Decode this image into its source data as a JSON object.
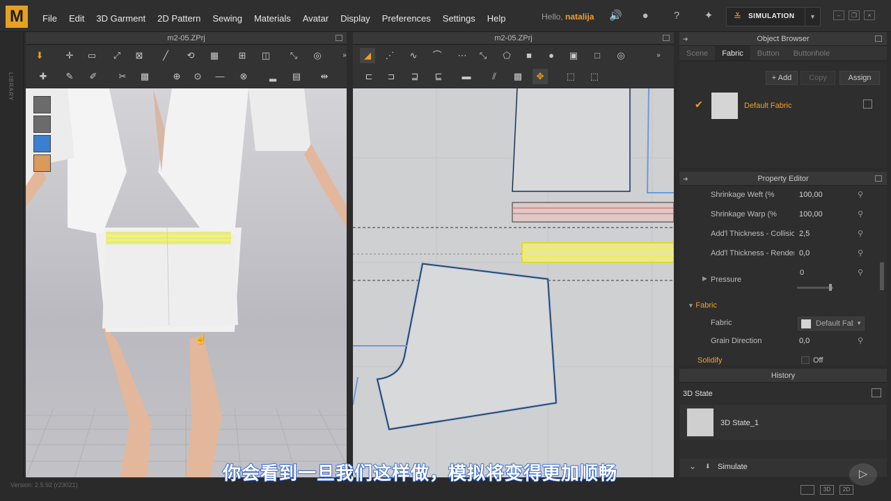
{
  "app": {
    "logo": "M",
    "user_greeting": "Hello,",
    "user_name": "natalija",
    "simulation_label": "SIMULATION"
  },
  "menu": [
    "File",
    "Edit",
    "3D Garment",
    "2D Pattern",
    "Sewing",
    "Materials",
    "Avatar",
    "Display",
    "Preferences",
    "Settings",
    "Help"
  ],
  "library_label": "LIBRARY",
  "panes": {
    "left_title": "m2-05.ZPrj",
    "right_title": "m2-05.ZPrj"
  },
  "object_browser": {
    "title": "Object Browser",
    "tabs": [
      "Scene",
      "Fabric",
      "Button",
      "Buttonhole"
    ],
    "active_tab": "Fabric",
    "add": "+ Add",
    "copy": "Copy",
    "assign": "Assign",
    "fabric_item": "Default Fabric"
  },
  "property_editor": {
    "title": "Property Editor",
    "rows": [
      {
        "k": "Shrinkage Weft (%",
        "v": "100,00"
      },
      {
        "k": "Shrinkage Warp (%",
        "v": "100,00"
      },
      {
        "k": "Add'l Thickness - Collision",
        "v": "2,5"
      },
      {
        "k": "Add'l Thickness - Rendering",
        "v": "0,0"
      }
    ],
    "pressure_label": "Pressure",
    "pressure_value": "0",
    "fabric_section": "Fabric",
    "fabric_label": "Fabric",
    "fabric_value": "Default Fabric",
    "grain_label": "Grain Direction",
    "grain_value": "0,0",
    "solidify_label": "Solidify",
    "solidify_value": "Off"
  },
  "history": {
    "title": "History",
    "state_header": "3D State",
    "state_item": "3D State_1",
    "simulate": "Simulate"
  },
  "status": {
    "version": "Version: 2.5.92    (r23021)"
  },
  "subtitle": "你会看到一旦我们这样做，模拟将变得更加顺畅"
}
